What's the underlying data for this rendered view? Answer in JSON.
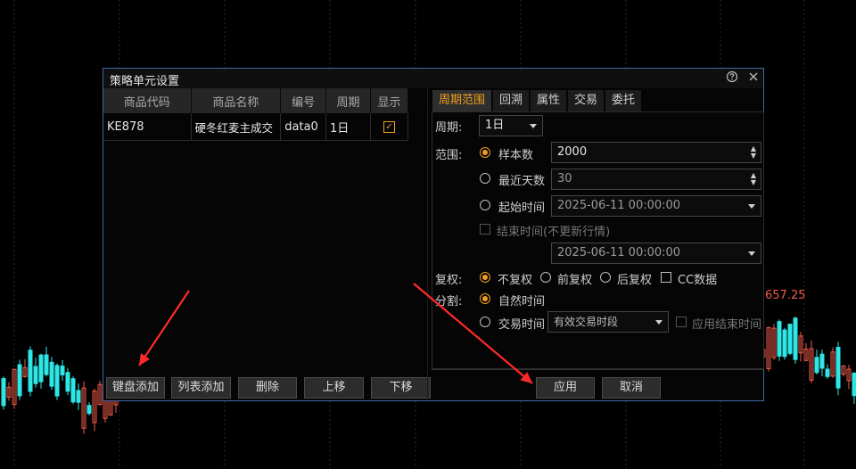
{
  "background": {
    "price_label": "657.25"
  },
  "dialog": {
    "title": "策略单元设置",
    "help_icon": "help-icon",
    "close_icon": "close-icon",
    "table": {
      "headers": [
        "商品代码",
        "商品名称",
        "编号",
        "周期",
        "显示"
      ],
      "rows": [
        [
          "KE878",
          "硬冬红麦主成交",
          "data0",
          "1日",
          "✓"
        ]
      ]
    },
    "left_buttons": [
      "键盘添加",
      "列表添加",
      "删除",
      "上移",
      "下移"
    ],
    "tabs": [
      "周期范围",
      "回溯",
      "属性",
      "交易",
      "委托"
    ],
    "period_label": "周期:",
    "period_value": "1日",
    "range_label": "范围:",
    "range_options": {
      "sample_count": {
        "label": "样本数",
        "value": "2000"
      },
      "recent_days": {
        "label": "最近天数",
        "value": "30"
      },
      "start_time": {
        "label": "起始时间",
        "value": "2025-06-11 00:00:00"
      }
    },
    "end_time_label": "结束时间(不更新行情)",
    "end_time_value": "2025-06-11 00:00:00",
    "adjust_label": "复权:",
    "adjust_options": [
      "不复权",
      "前复权",
      "后复权"
    ],
    "cc_data_label": "CC数据",
    "split_label": "分割:",
    "split_options": [
      "自然时间",
      "交易时间"
    ],
    "trade_period_value": "有效交易时段",
    "apply_end_time_label": "应用结束时间",
    "apply_button": "应用",
    "cancel_button": "取消",
    "colors": {
      "accent": "#f0a020",
      "border": "#3d6aa3",
      "bull": "#f05a4a",
      "bear": "#2ee6e6"
    }
  }
}
